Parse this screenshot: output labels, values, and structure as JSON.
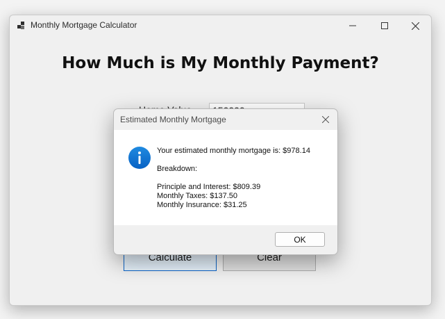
{
  "window": {
    "title": "Monthly Mortgage Calculator",
    "heading": "How Much is My Monthly Payment?",
    "home_value_label": "Home Value",
    "home_value_input": "150000",
    "calculate_label": "Calculate",
    "clear_label": "Clear"
  },
  "dialog": {
    "title": "Estimated Monthly Mortgage",
    "line_estimate": "Your estimated monthly mortgage is: $978.14",
    "line_breakdown": "Breakdown:",
    "line_principal": "Principle and Interest: $809.39",
    "line_taxes": "Monthly Taxes: $137.50",
    "line_insurance": "Monthly Insurance: $31.25",
    "ok_label": "OK"
  },
  "icons": {
    "app": "app-grid-icon",
    "minimize": "minimize-icon",
    "maximize": "maximize-icon",
    "close": "close-icon",
    "info": "info-icon"
  },
  "colors": {
    "accent": "#0a64c8",
    "info_blue": "#0a74d4"
  }
}
